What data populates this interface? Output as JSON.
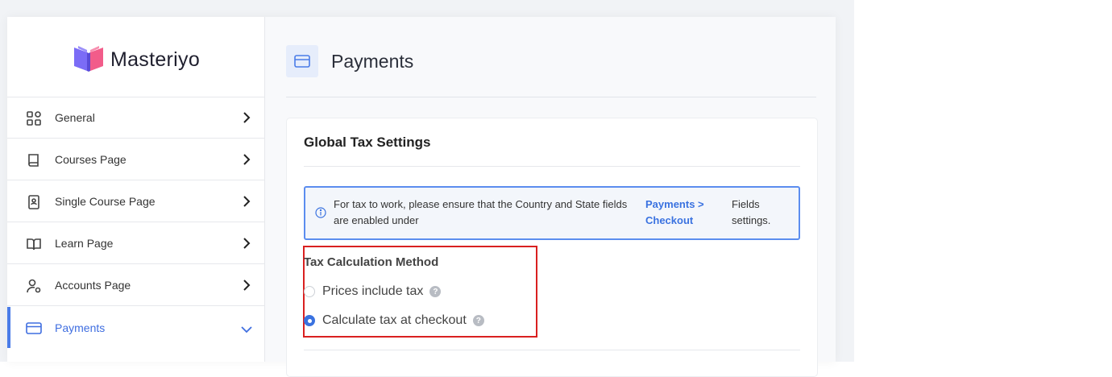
{
  "brand": {
    "name": "Masteriyo"
  },
  "sidebar": {
    "items": [
      {
        "label": "General",
        "icon": "grid-icon"
      },
      {
        "label": "Courses Page",
        "icon": "book-icon"
      },
      {
        "label": "Single Course Page",
        "icon": "contact-book-icon"
      },
      {
        "label": "Learn Page",
        "icon": "open-book-icon"
      },
      {
        "label": "Accounts Page",
        "icon": "user-settings-icon"
      },
      {
        "label": "Payments",
        "icon": "credit-card-icon",
        "active": true
      }
    ]
  },
  "header": {
    "title": "Payments",
    "icon": "credit-card-icon"
  },
  "card": {
    "title": "Global Tax Settings",
    "notice": {
      "message": "For tax to work, please ensure that the Country and State fields are enabled under",
      "link": "Payments > Checkout",
      "tail": "Fields settings."
    },
    "tax_method": {
      "label": "Tax Calculation Method",
      "options": [
        {
          "label": "Prices include tax",
          "selected": false
        },
        {
          "label": "Calculate tax at checkout",
          "selected": true
        }
      ],
      "help_glyph": "?"
    }
  },
  "colors": {
    "accent": "#3a72e0",
    "highlight": "#d92020",
    "notice_border": "#5b8def"
  }
}
